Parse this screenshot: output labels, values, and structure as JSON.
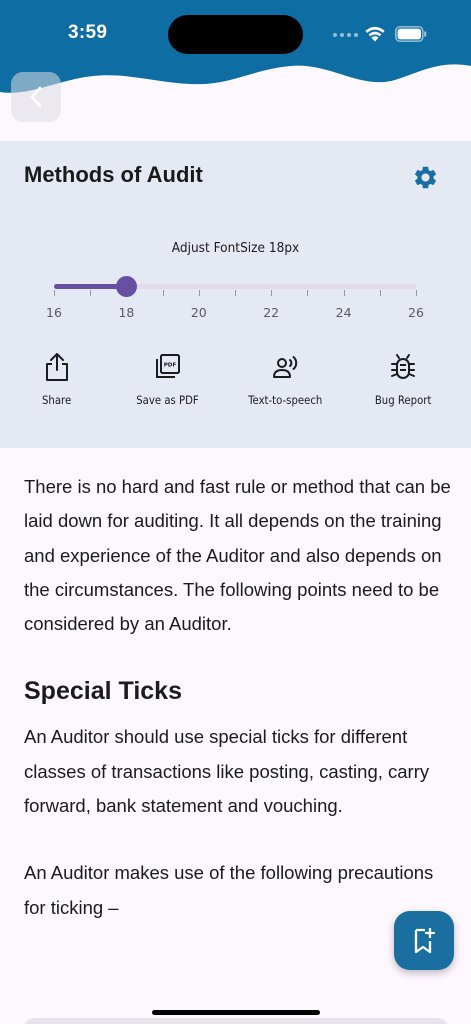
{
  "status_bar": {
    "time": "3:59"
  },
  "colors": {
    "header": "#0E6EA3",
    "accent": "#6750A4",
    "panel": "#E4E9F4",
    "fab": "#1A6FA0"
  },
  "header": {
    "title": "Methods of Audit"
  },
  "font_control": {
    "label": "Adjust FontSize 18px",
    "min": 16,
    "max": 26,
    "value": 18,
    "tick_labels": [
      "16",
      "18",
      "20",
      "22",
      "24",
      "26"
    ]
  },
  "actions": [
    {
      "label": "Share",
      "icon": "share-icon"
    },
    {
      "label": "Save as PDF",
      "icon": "pdf-icon"
    },
    {
      "label": "Text-to-speech",
      "icon": "speaker-icon"
    },
    {
      "label": "Bug Report",
      "icon": "bug-icon"
    }
  ],
  "article": {
    "intro": "There is no hard and fast rule or method that can be laid down for auditing. It all depends on the training and experience of the Auditor and also depends on the circumstances. The following points need to be considered by an Auditor.",
    "section_heading": "Special Ticks",
    "section_para1": "An Auditor should use special ticks for different classes of transactions like posting, casting, carry forward, bank statement and vouching.",
    "section_para2": "An Auditor makes use of the following precautions for ticking –"
  },
  "fab": {
    "icon": "bookmark-add-icon"
  }
}
